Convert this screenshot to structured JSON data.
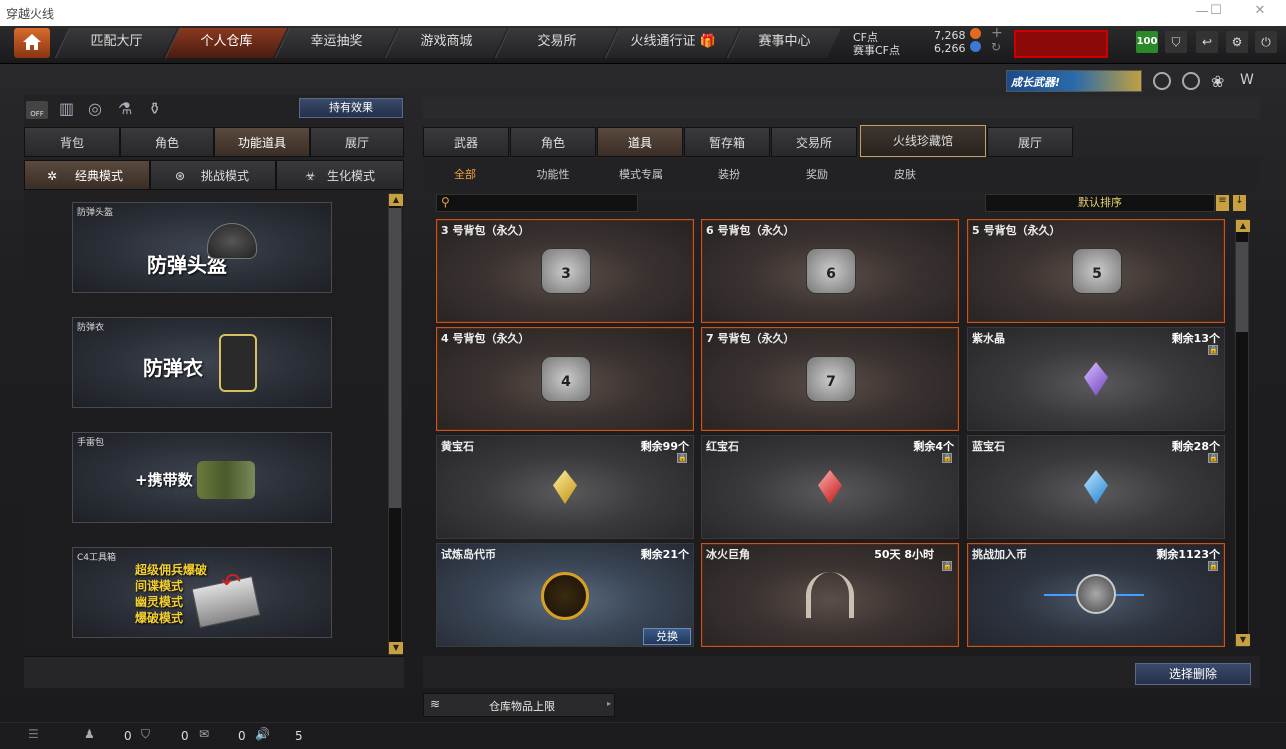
{
  "window": {
    "title": "穿越火线"
  },
  "nav": {
    "tabs": [
      "匹配大厅",
      "个人仓库",
      "幸运抽奖",
      "游戏商城",
      "交易所",
      "火线通行证",
      "赛事中心"
    ],
    "active": 1
  },
  "currency": {
    "cf_label": "CF点",
    "cf_value": "7,268",
    "event_label": "赛事CF点",
    "event_value": "6,266"
  },
  "top_right": {
    "level": "100"
  },
  "banner": {
    "text": "成长武器!"
  },
  "left": {
    "effects_button": "持有效果",
    "off_label": "OFF",
    "tabs": [
      "背包",
      "角色",
      "功能道具",
      "展厅"
    ],
    "tabs_active": 2,
    "modes": [
      "经典模式",
      "挑战模式",
      "生化模式"
    ],
    "items": [
      {
        "label": "防弹头盔",
        "big": "防弹头盔"
      },
      {
        "label": "防弹衣",
        "big": "防弹衣"
      },
      {
        "label": "手雷包",
        "big": "+携带数"
      },
      {
        "label": "C4工具箱",
        "lines": [
          "超级佣兵爆破",
          "间谍模式",
          "幽灵模式",
          "爆破模式"
        ]
      }
    ]
  },
  "right": {
    "tabs": [
      "武器",
      "角色",
      "道具",
      "暂存箱",
      "交易所",
      "火线珍藏馆",
      "展厅"
    ],
    "tabs_active": 2,
    "categories": [
      "全部",
      "功能性",
      "模式专属",
      "装扮",
      "奖励",
      "皮肤"
    ],
    "categories_active": 0,
    "sort": "默认排序",
    "items": [
      {
        "name": "3 号背包（永久）",
        "count": "",
        "icon": "bag-3"
      },
      {
        "name": "6 号背包（永久）",
        "count": "",
        "icon": "bag-6"
      },
      {
        "name": "5 号背包（永久）",
        "count": "",
        "icon": "bag-5"
      },
      {
        "name": "4 号背包（永久）",
        "count": "",
        "icon": "bag-4"
      },
      {
        "name": "7 号背包（永久）",
        "count": "",
        "icon": "bag-7"
      },
      {
        "name": "紫水晶",
        "count": "剩余13个",
        "icon": "purple-crystal"
      },
      {
        "name": "黄宝石",
        "count": "剩余99个",
        "icon": "yellow-gem"
      },
      {
        "name": "红宝石",
        "count": "剩余4个",
        "icon": "red-gem"
      },
      {
        "name": "蓝宝石",
        "count": "剩余28个",
        "icon": "blue-gem"
      },
      {
        "name": "试炼岛代币",
        "count": "剩余21个",
        "icon": "trial-coin",
        "button": "兑换"
      },
      {
        "name": "冰火巨角",
        "count": "50天 8小时",
        "icon": "horns"
      },
      {
        "name": "挑战加入币",
        "count": "剩余1123个",
        "icon": "challenge-coin"
      }
    ],
    "delete_button": "选择删除",
    "capacity": "仓库物品上限"
  },
  "status": {
    "friends": "0",
    "clan": "0",
    "msg": "0",
    "volume": "5"
  },
  "colors": {
    "accent": "#c4561e",
    "active_tab": "#8a3a20"
  }
}
